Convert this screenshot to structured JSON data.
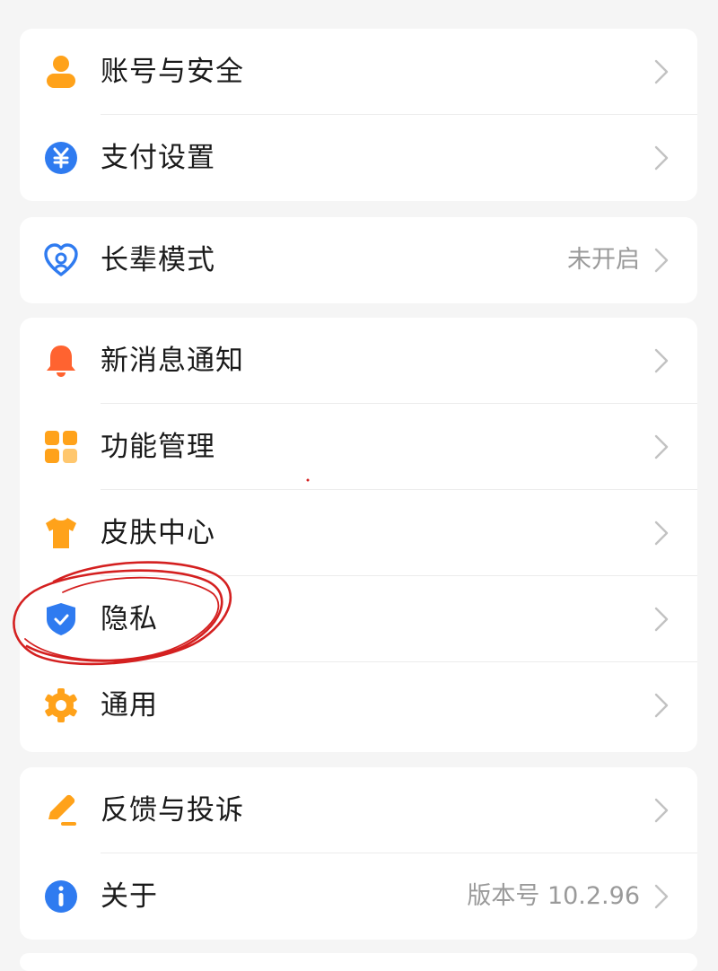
{
  "groups": [
    {
      "items": [
        {
          "label": "账号与安全",
          "value": "",
          "icon": "person-icon"
        },
        {
          "label": "支付设置",
          "value": "",
          "icon": "yuan-icon"
        }
      ]
    },
    {
      "items": [
        {
          "label": "长辈模式",
          "value": "未开启",
          "icon": "heart-icon"
        }
      ]
    },
    {
      "items": [
        {
          "label": "新消息通知",
          "value": "",
          "icon": "bell-icon"
        },
        {
          "label": "功能管理",
          "value": "",
          "icon": "grid-icon"
        },
        {
          "label": "皮肤中心",
          "value": "",
          "icon": "tshirt-icon"
        },
        {
          "label": "隐私",
          "value": "",
          "icon": "shield-icon"
        },
        {
          "label": "通用",
          "value": "",
          "icon": "gear-icon"
        }
      ]
    },
    {
      "items": [
        {
          "label": "反馈与投诉",
          "value": "",
          "icon": "pencil-icon"
        },
        {
          "label": "关于",
          "value": "版本号 10.2.96",
          "icon": "info-icon"
        }
      ]
    }
  ],
  "colors": {
    "background": "#f5f5f5",
    "orange": "#ffa21a",
    "blue": "#2f7bf0",
    "red_bell": "#ff6330",
    "annotation": "#d42020"
  }
}
